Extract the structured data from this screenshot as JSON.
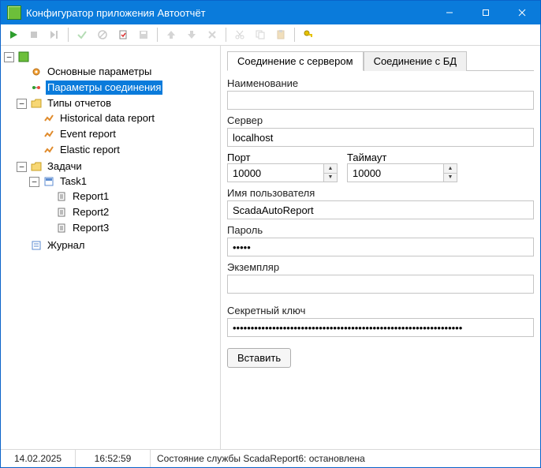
{
  "window": {
    "title": "Конфигуратор приложения Автоотчёт"
  },
  "tree": {
    "root": {
      "main_params": "Основные параметры",
      "conn_params": "Параметры соединения",
      "report_types": "Типы отчетов",
      "historical": "Historical data report",
      "event": "Event report",
      "elastic": "Elastic report",
      "tasks": "Задачи",
      "task1": "Task1",
      "report1": "Report1",
      "report2": "Report2",
      "report3": "Report3",
      "journal": "Журнал"
    }
  },
  "tabs": {
    "server": "Соединение с сервером",
    "db": "Соединение с БД"
  },
  "form": {
    "name_label": "Наименование",
    "name_value": "",
    "server_label": "Сервер",
    "server_value": "localhost",
    "port_label": "Порт",
    "port_value": "10000",
    "timeout_label": "Таймаут",
    "timeout_value": "10000",
    "user_label": "Имя пользователя",
    "user_value": "ScadaAutoReport",
    "password_label": "Пароль",
    "password_value": "•••••",
    "instance_label": "Экземпляр",
    "instance_value": "",
    "secret_label": "Секретный ключ",
    "secret_value": "••••••••••••••••••••••••••••••••••••••••••••••••••••••••••••••••",
    "paste_button": "Вставить"
  },
  "status": {
    "date": "14.02.2025",
    "time": "16:52:59",
    "text": "Состояние службы ScadaReport6: остановлена"
  }
}
